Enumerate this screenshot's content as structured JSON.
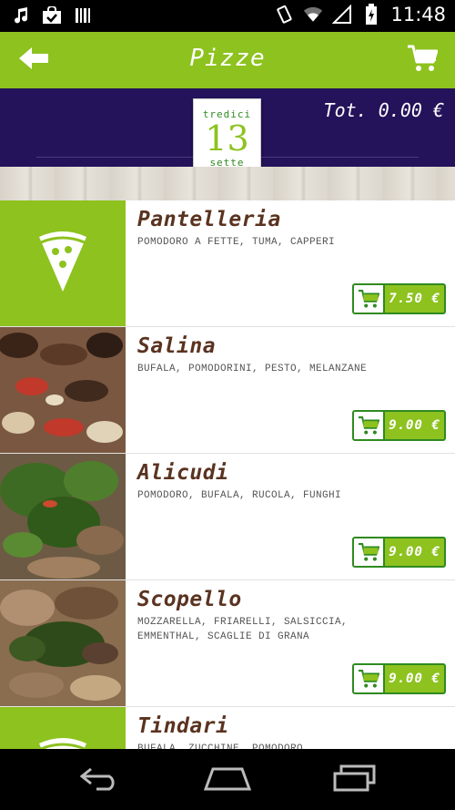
{
  "status_bar": {
    "time": "11:48"
  },
  "action_bar": {
    "title": "Pizze"
  },
  "header": {
    "total": "Tot. 0.00 €",
    "logo_top": "tredici",
    "logo_mark": "13",
    "logo_bottom": "sette"
  },
  "items": [
    {
      "name": "Pantelleria",
      "ingredients": "POMODORO A FETTE, TUMA, CAPPERI",
      "price": "7.50 €"
    },
    {
      "name": "Salina",
      "ingredients": "BUFALA, POMODORINI, PESTO, MELANZANE",
      "price": "9.00 €"
    },
    {
      "name": "Alicudi",
      "ingredients": "POMODORO, BUFALA, RUCOLA, FUNGHI",
      "price": "9.00 €"
    },
    {
      "name": "Scopello",
      "ingredients": "MOZZARELLA, FRIARELLI, SALSICCIA, EMMENTHAL, SCAGLIE DI GRANA",
      "price": "9.00 €"
    },
    {
      "name": "Tindari",
      "ingredients": "BUFALA, ZUCCHINE, POMODORO SOLEGGIATO,",
      "price": ""
    }
  ],
  "colors": {
    "accent": "#8dc21f",
    "header": "#24125a",
    "price_border": "#2f8a20",
    "name": "#5a3320"
  }
}
